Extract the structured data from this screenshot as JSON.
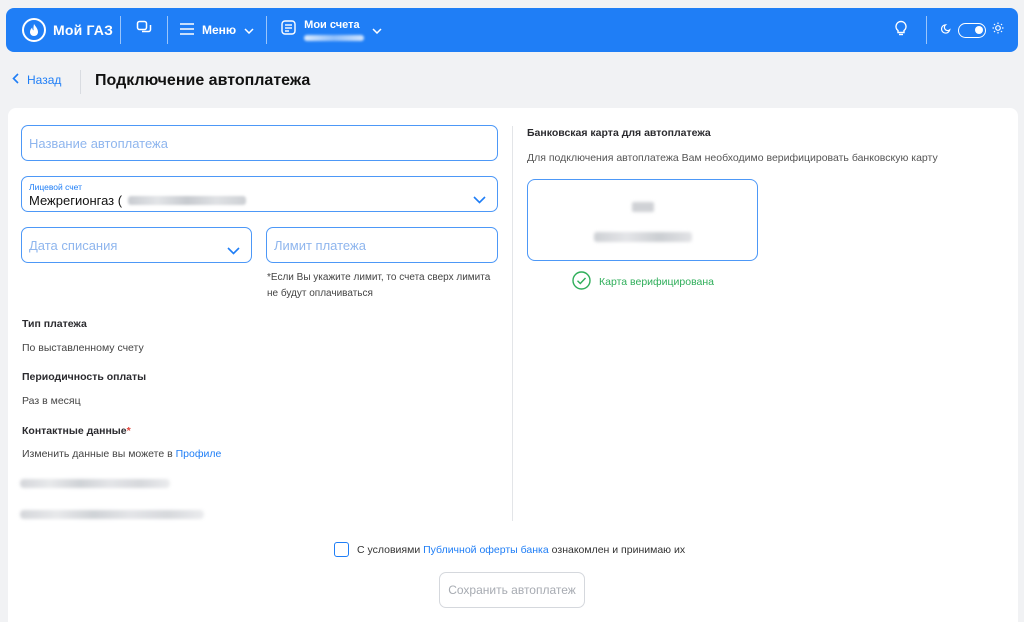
{
  "header": {
    "logo_text": "Мой ГАЗ",
    "menu_label": "Меню",
    "accounts_title": "Мои счета"
  },
  "subheader": {
    "back_label": "Назад",
    "title": "Подключение автоплатежа"
  },
  "form": {
    "name_placeholder": "Название автоплатежа",
    "account_label": "Лицевой счет",
    "account_value": "Межрегионгаз (",
    "date_placeholder": "Дата списания",
    "limit_placeholder": "Лимит платежа",
    "limit_note": "*Если Вы укажите лимит, то счета сверх лимита не будут оплачиваться",
    "payment_type_label": "Тип платежа",
    "payment_type_value": "По выставленному счету",
    "periodicity_label": "Периодичность оплаты",
    "periodicity_value": "Раз в месяц",
    "contacts_label": "Контактные данные",
    "contacts_required": "*",
    "contacts_hint_prefix": "Изменить данные вы можете в ",
    "contacts_hint_link": "Профиле"
  },
  "card_section": {
    "title": "Банковская карта для автоплатежа",
    "description": "Для подключения автоплатежа Вам необходимо верифицировать банковскую карту",
    "verified_label": "Карта верифицирована"
  },
  "footer": {
    "agree_prefix": "С условиями ",
    "agree_link": "Публичной оферты банка",
    "agree_suffix": " ознакомлен и принимаю их",
    "save_label": "Сохранить автоплатеж"
  },
  "colors": {
    "brand": "#1f7ef6",
    "success": "#2fae5a",
    "required": "#e0443a"
  },
  "icons": [
    "gas-flame-logo-icon",
    "chat-icon",
    "hamburger-icon",
    "chevron-down-icon",
    "account-list-icon",
    "lightbulb-icon",
    "moon-icon",
    "sun-icon",
    "chevron-left-icon",
    "check-circle-icon"
  ]
}
